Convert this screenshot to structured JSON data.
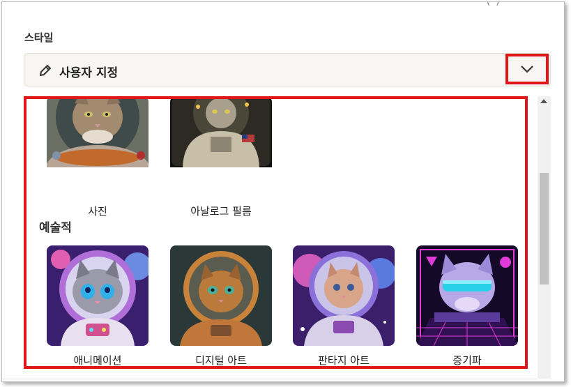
{
  "header": {
    "cut_text": "( ) ",
    "section_label": "스타일"
  },
  "dropdown": {
    "selected": "사용자 지정",
    "icon": "pencil-icon",
    "toggle_icon": "chevron-down-icon"
  },
  "styles": {
    "top_row": [
      {
        "label": "사진",
        "theme": "photo"
      },
      {
        "label": "아날로그 필름",
        "theme": "film"
      }
    ],
    "category": "예술적",
    "artistic_row": [
      {
        "label": "애니메이션",
        "theme": "anime"
      },
      {
        "label": "디지털 아트",
        "theme": "digital"
      },
      {
        "label": "판타지 아트",
        "theme": "fantasy"
      },
      {
        "label": "증기파",
        "theme": "vaporwave"
      }
    ]
  },
  "colors": {
    "highlight": "#e0161b",
    "dropdown_bg": "#f8f6f2"
  }
}
